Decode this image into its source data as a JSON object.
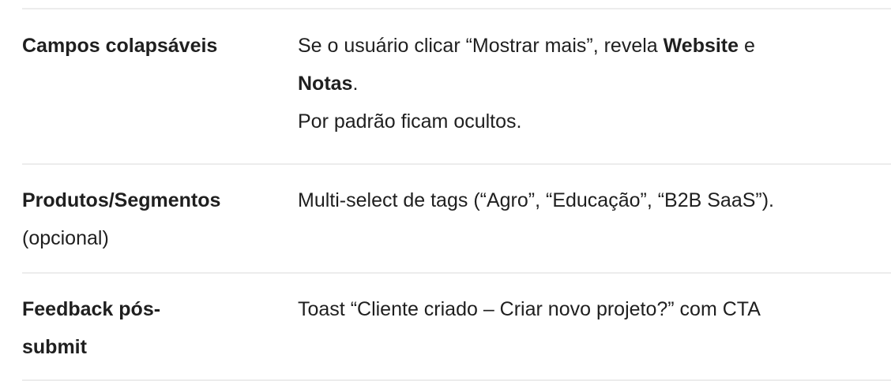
{
  "rows": [
    {
      "label_bold": "Campos colapsáveis",
      "desc_line1_pre": "Se o usuário clicar “Mostrar mais”, revela ",
      "desc_line1_bold": "Website",
      "desc_line1_post": " e",
      "desc_line2_bold": "Notas",
      "desc_line2_post": ".",
      "desc_line3": "Por padrão ficam ocultos."
    },
    {
      "label_bold": "Produtos/Segmentos",
      "label_normal": "(opcional)",
      "desc": "Multi-select de tags (“Agro”, “Educação”, “B2B SaaS”)."
    },
    {
      "label_bold_line1": "Feedback pós-",
      "label_bold_line2": "submit",
      "desc": "Toast “Cliente criado – Criar novo projeto?” com CTA"
    }
  ]
}
